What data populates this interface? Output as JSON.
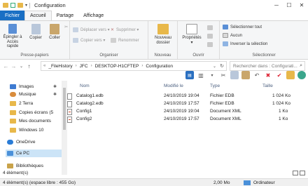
{
  "window": {
    "title": "Configuration"
  },
  "tabs": [
    "Fichier",
    "Accueil",
    "Partage",
    "Affichage"
  ],
  "ribbon": {
    "epingler": "Épingler à\nAccès rapide",
    "copier": "Copier",
    "coller": "Coller",
    "presse_papiers": "Presse-papiers",
    "deplacer": "Déplacer vers ▾",
    "supprimer": "Supprimer ▾",
    "copier_vers": "Copier vers ▾",
    "renommer": "Renommer",
    "organiser": "Organiser",
    "nouveau_dossier": "Nouveau\ndossier",
    "nouveau": "Nouveau",
    "proprietes": "Propriétés\n▾",
    "ouvrir": "Ouvrir",
    "selectionner_tout": "Sélectionner tout",
    "aucun": "Aucun",
    "inverser": "Inverser la sélection",
    "selectionner": "Sélectionner"
  },
  "address": {
    "crumbs": [
      "_FileHistory",
      "JFC",
      "DESKTOP-H1CFTEP",
      "Configuration"
    ],
    "search_placeholder": "Rechercher dans : Configurati..."
  },
  "nav": [
    {
      "label": "Images",
      "color": "#3e7bd1",
      "pin": "✱"
    },
    {
      "label": "Musique",
      "color": "#d98c3c",
      "pin": "✱"
    },
    {
      "label": "2 Terra",
      "color": "#e8b84a",
      "pin": ""
    },
    {
      "label": "Copies écrans (5",
      "color": "#e8b84a",
      "pin": ""
    },
    {
      "label": "Mes documents",
      "color": "#e8b84a",
      "pin": ""
    },
    {
      "label": "Windows 10",
      "color": "#e8b84a",
      "pin": ""
    },
    {
      "label": "OneDrive",
      "color": "#2a7cd6",
      "pin": ""
    },
    {
      "label": "Ce PC",
      "color": "#4a90d9",
      "pin": ""
    },
    {
      "label": "Bibliothèques",
      "color": "#c9a34a",
      "pin": ""
    }
  ],
  "columns": {
    "name": "Nom",
    "modified": "Modifié le",
    "type": "Type",
    "size": "Taille"
  },
  "files": [
    {
      "name": "Catalog1.edb",
      "modified": "24/10/2019 19:04",
      "type": "Fichier EDB",
      "size": "1 024 Ko",
      "xml": false
    },
    {
      "name": "Catalog2.edb",
      "modified": "24/10/2019 17:57",
      "type": "Fichier EDB",
      "size": "1 024 Ko",
      "xml": false
    },
    {
      "name": "Config1",
      "modified": "24/10/2019 19:04",
      "type": "Document XML",
      "size": "1 Ko",
      "xml": true
    },
    {
      "name": "Config2",
      "modified": "24/10/2019 17:57",
      "type": "Document XML",
      "size": "1 Ko",
      "xml": true
    }
  ],
  "status": {
    "count": "4 élément(s)",
    "selection": "4 élément(s) (espace libre : 455 Go)",
    "size": "2,00 Mo",
    "computer": "Ordinateur"
  }
}
